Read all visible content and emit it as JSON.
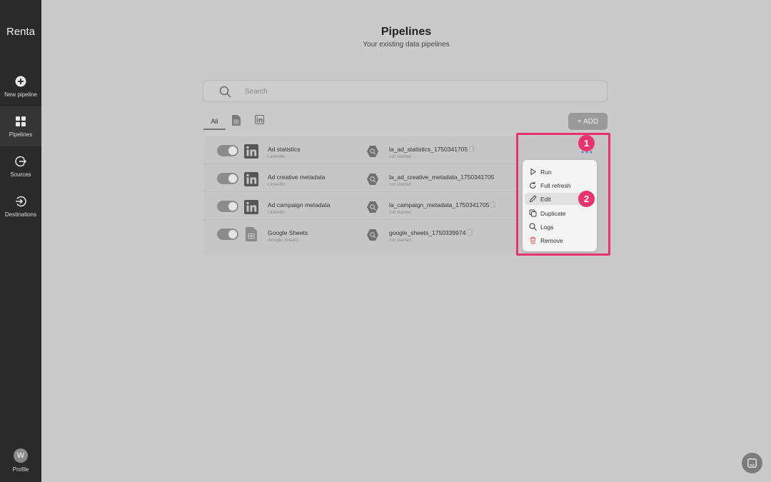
{
  "app": {
    "brand": "Renta"
  },
  "sidebar": {
    "items": [
      {
        "label": "New pipeline",
        "icon": "plus-circle-icon"
      },
      {
        "label": "Pipelines",
        "icon": "grid-icon",
        "active": true
      },
      {
        "label": "Sources",
        "icon": "source-icon"
      },
      {
        "label": "Destinations",
        "icon": "destination-icon"
      }
    ],
    "profile": {
      "initial": "W",
      "label": "Profile"
    }
  },
  "header": {
    "title": "Pipelines",
    "subtitle": "Your existing data pipelines"
  },
  "search": {
    "placeholder": "Search"
  },
  "tabs": [
    {
      "label": "All",
      "active": true
    },
    {
      "icon": "google-sheets-icon"
    },
    {
      "icon": "linkedin-icon"
    }
  ],
  "add_button": {
    "label": "+ ADD"
  },
  "pipelines": [
    {
      "enabled": true,
      "source_name": "Ad statistics",
      "source_type": "LinkedIn",
      "source_icon": "linkedin-icon",
      "dest_name": "la_ad_statistics_1750341705",
      "status": "not started"
    },
    {
      "enabled": true,
      "source_name": "Ad creative metadata",
      "source_type": "LinkedIn",
      "source_icon": "linkedin-icon",
      "dest_name": "la_ad_creative_metadata_1750341705",
      "status": "not started"
    },
    {
      "enabled": true,
      "source_name": "Ad campaign metadata",
      "source_type": "LinkedIn",
      "source_icon": "linkedin-icon",
      "dest_name": "la_campaign_metadata_1750341705",
      "status": "not started"
    },
    {
      "enabled": true,
      "source_name": "Google Sheets",
      "source_type": "Google Sheets",
      "source_icon": "google-sheets-icon",
      "dest_name": "google_sheets_1750339974",
      "status": "not started"
    }
  ],
  "context_menu": {
    "items": [
      {
        "label": "Run",
        "icon": "play-icon"
      },
      {
        "label": "Full refresh",
        "icon": "refresh-icon"
      },
      {
        "label": "Edit",
        "icon": "pencil-icon"
      },
      {
        "label": "Duplicate",
        "icon": "duplicate-icon"
      },
      {
        "label": "Logs",
        "icon": "search-icon"
      },
      {
        "label": "Remove",
        "icon": "trash-icon",
        "color": "#e05a4f"
      }
    ]
  },
  "annotations": {
    "badge1": "1",
    "badge2": "2",
    "color": "#e8336e"
  }
}
